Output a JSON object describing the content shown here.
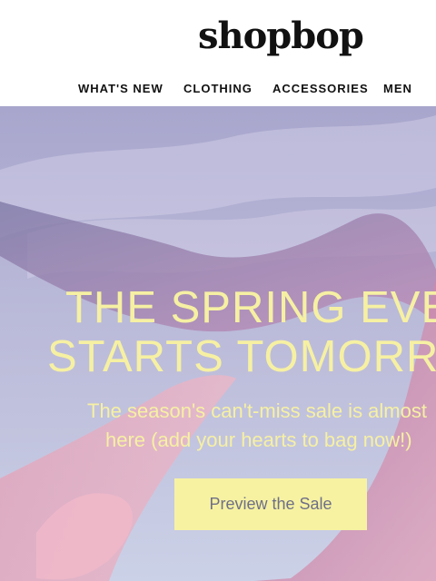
{
  "brand": {
    "logo_text": "shopbop"
  },
  "nav": {
    "items": [
      {
        "label": "WHAT'S NEW"
      },
      {
        "label": "CLOTHING"
      },
      {
        "label": "ACCESSORIES"
      },
      {
        "label": "MEN"
      }
    ]
  },
  "hero": {
    "headline_line1": "THE SPRING EVENT",
    "headline_line2": "STARTS TOMORROW",
    "subtext_line1": "The season's can't-miss sale is almost",
    "subtext_line2": "here (add your hearts to bag now!)",
    "cta_label": "Preview the Sale"
  },
  "colors": {
    "accent_yellow": "#f6f2a2",
    "text_yellow": "#f6f0a3",
    "cta_text": "#6f6f88"
  }
}
